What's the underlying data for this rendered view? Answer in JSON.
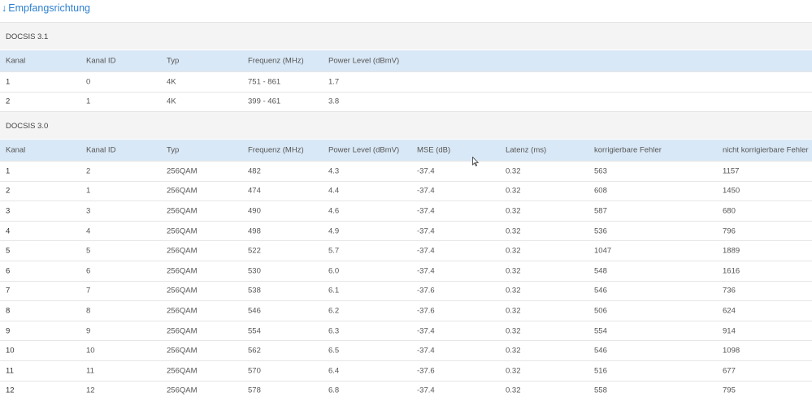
{
  "heading": {
    "arrow": "↓",
    "title": "Empfangsrichtung"
  },
  "docsis31": {
    "label": "DOCSIS 3.1",
    "columns": [
      "Kanal",
      "Kanal ID",
      "Typ",
      "Frequenz (MHz)",
      "Power Level (dBmV)"
    ],
    "rows": [
      [
        "1",
        "0",
        "4K",
        "751 - 861",
        "1.7"
      ],
      [
        "2",
        "1",
        "4K",
        "399 - 461",
        "3.8"
      ]
    ]
  },
  "docsis30": {
    "label": "DOCSIS 3.0",
    "columns": [
      "Kanal",
      "Kanal ID",
      "Typ",
      "Frequenz (MHz)",
      "Power Level (dBmV)",
      "MSE (dB)",
      "Latenz (ms)",
      "korrigierbare Fehler",
      "nicht korrigierbare Fehler"
    ],
    "rows": [
      [
        "1",
        "2",
        "256QAM",
        "482",
        "4.3",
        "-37.4",
        "0.32",
        "563",
        "1157"
      ],
      [
        "2",
        "1",
        "256QAM",
        "474",
        "4.4",
        "-37.4",
        "0.32",
        "608",
        "1450"
      ],
      [
        "3",
        "3",
        "256QAM",
        "490",
        "4.6",
        "-37.4",
        "0.32",
        "587",
        "680"
      ],
      [
        "4",
        "4",
        "256QAM",
        "498",
        "4.9",
        "-37.4",
        "0.32",
        "536",
        "796"
      ],
      [
        "5",
        "5",
        "256QAM",
        "522",
        "5.7",
        "-37.4",
        "0.32",
        "1047",
        "1889"
      ],
      [
        "6",
        "6",
        "256QAM",
        "530",
        "6.0",
        "-37.4",
        "0.32",
        "548",
        "1616"
      ],
      [
        "7",
        "7",
        "256QAM",
        "538",
        "6.1",
        "-37.6",
        "0.32",
        "546",
        "736"
      ],
      [
        "8",
        "8",
        "256QAM",
        "546",
        "6.2",
        "-37.6",
        "0.32",
        "506",
        "624"
      ],
      [
        "9",
        "9",
        "256QAM",
        "554",
        "6.3",
        "-37.4",
        "0.32",
        "554",
        "914"
      ],
      [
        "10",
        "10",
        "256QAM",
        "562",
        "6.5",
        "-37.4",
        "0.32",
        "546",
        "1098"
      ],
      [
        "11",
        "11",
        "256QAM",
        "570",
        "6.4",
        "-37.6",
        "0.32",
        "516",
        "677"
      ],
      [
        "12",
        "12",
        "256QAM",
        "578",
        "6.8",
        "-37.4",
        "0.32",
        "558",
        "795"
      ]
    ]
  },
  "colors": {
    "accent": "#2d7fcf",
    "header_bg": "#d9e8f6",
    "group_bg": "#f4f4f4"
  },
  "icons": {
    "cursor": "mouse-cursor-icon"
  }
}
